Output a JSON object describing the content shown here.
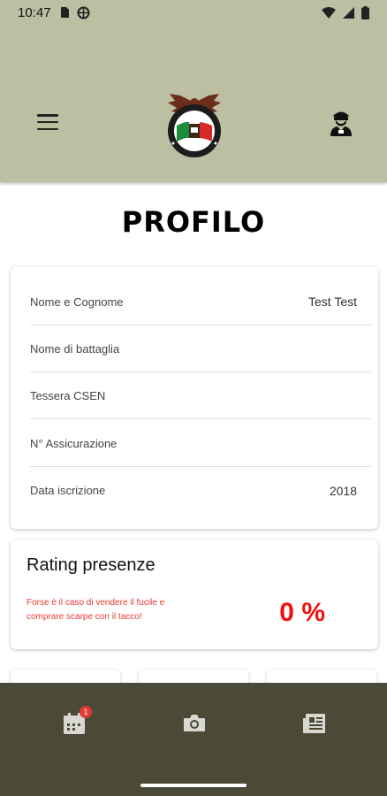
{
  "status_bar": {
    "time": "10:47"
  },
  "header": {
    "logo_icon": "eagle-flag-emblem",
    "menu_icon": "hamburger-menu-icon",
    "profile_icon": "soldier-icon"
  },
  "page": {
    "title": "PROFILO"
  },
  "profile": {
    "rows": [
      {
        "label": "Nome e Cognome",
        "value": "Test Test"
      },
      {
        "label": "Nome di battaglia",
        "value": ""
      },
      {
        "label": "Tessera CSEN",
        "value": ""
      },
      {
        "label": "N° Assicurazione",
        "value": ""
      },
      {
        "label": "Data iscrizione",
        "value": "2018"
      }
    ]
  },
  "rating": {
    "title": "Rating presenze",
    "message": "Forse è il caso di vendere il fucile e comprare scarpe con il tacco!",
    "value": "0 %"
  },
  "bottom_nav": {
    "items": [
      {
        "icon": "calendar-icon",
        "badge": "1"
      },
      {
        "icon": "camera-icon"
      },
      {
        "icon": "newspaper-icon"
      }
    ]
  },
  "colors": {
    "header_bg": "#bcbfa2",
    "nav_bg": "#4b4a36",
    "rating_red": "#f01010"
  }
}
